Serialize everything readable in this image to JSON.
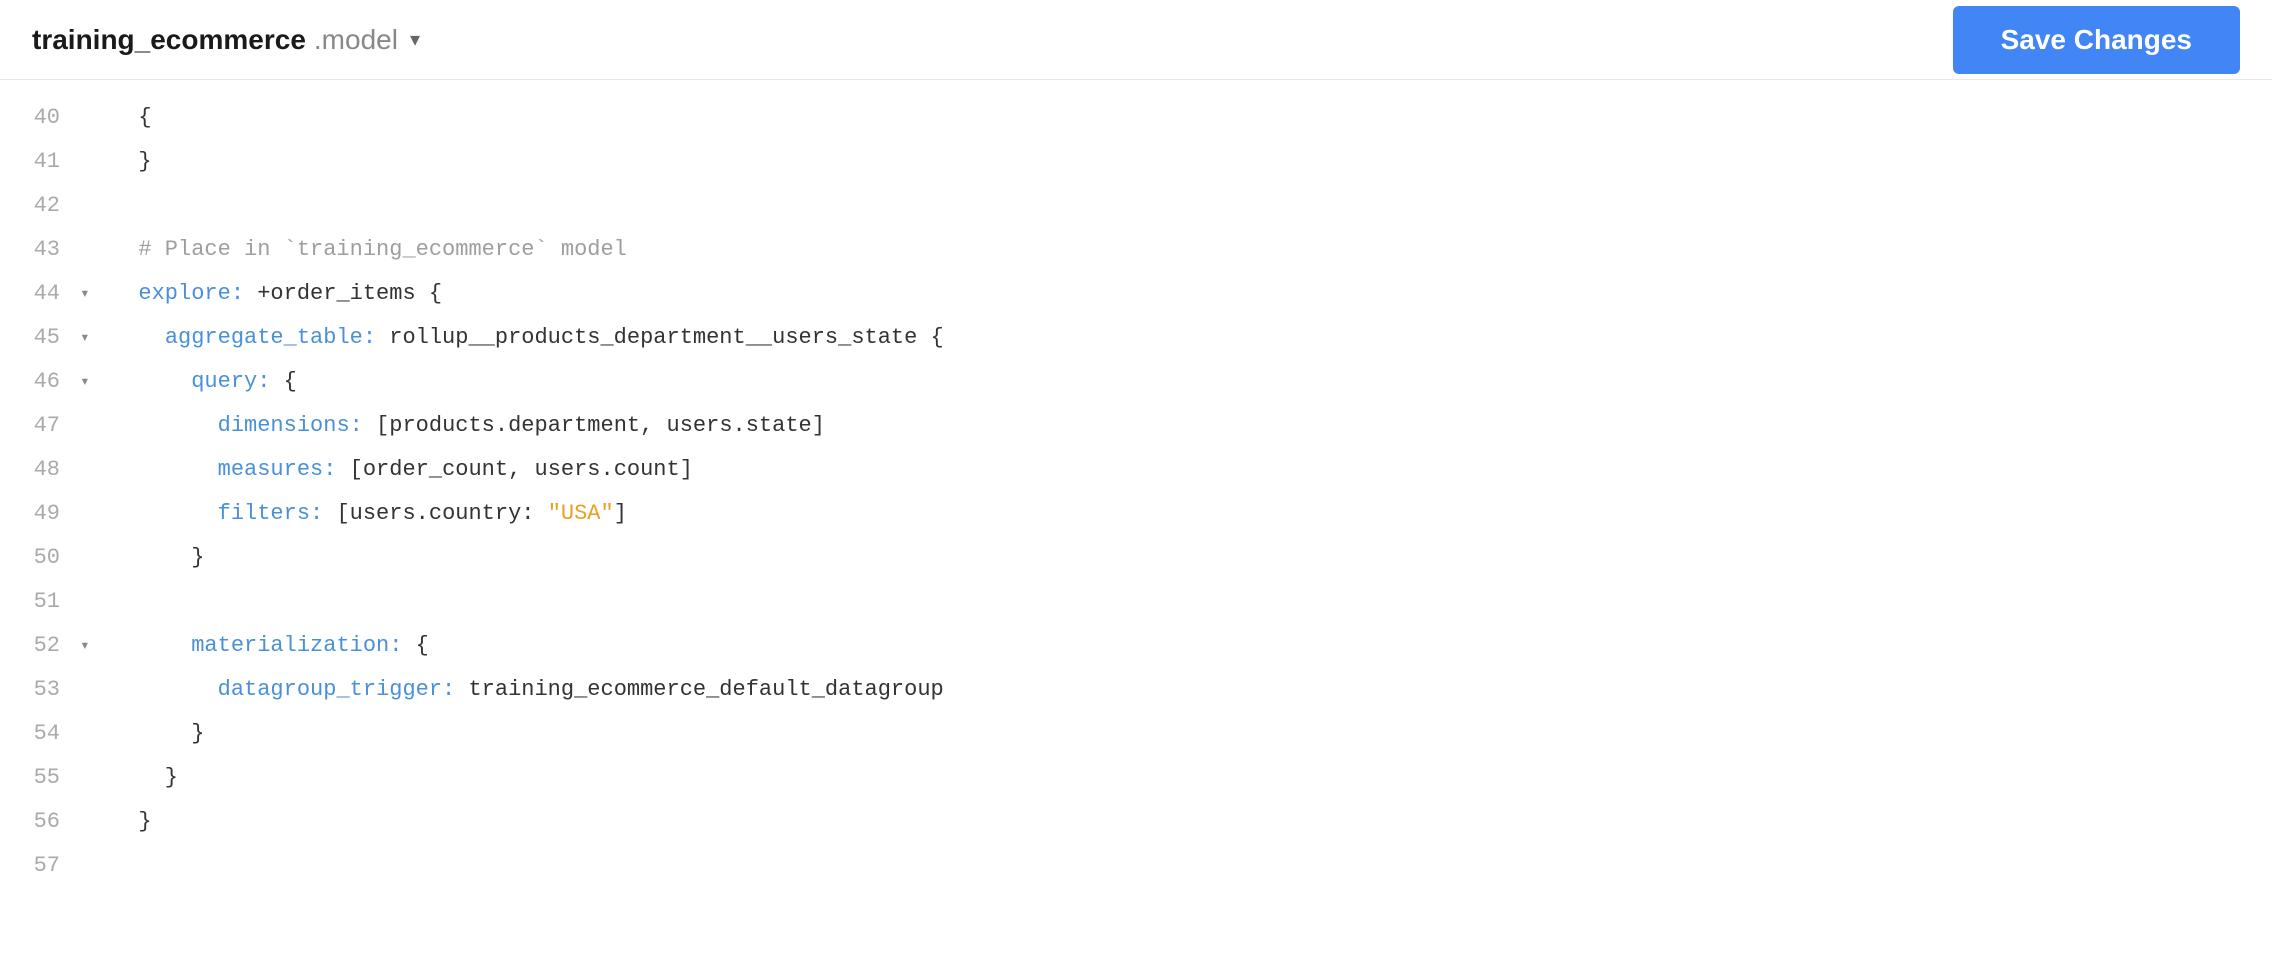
{
  "header": {
    "file_name": "training_ecommerce",
    "file_ext": ".model",
    "dropdown_icon": "▾",
    "save_button_label": "Save Changes"
  },
  "colors": {
    "save_btn_bg": "#4285f4",
    "keyword_blue": "#4a90d9",
    "string_orange": "#e8a020",
    "comment_gray": "#9e9e9e",
    "default_dark": "#444"
  },
  "lines": [
    {
      "num": "40",
      "fold": "",
      "tokens": [
        {
          "text": "  {",
          "class": "c-dark"
        }
      ]
    },
    {
      "num": "41",
      "fold": "",
      "tokens": [
        {
          "text": "  }",
          "class": "c-dark"
        }
      ]
    },
    {
      "num": "42",
      "fold": "",
      "tokens": []
    },
    {
      "num": "43",
      "fold": "",
      "tokens": [
        {
          "text": "  # Place in `training_ecommerce` model",
          "class": "c-comment"
        }
      ]
    },
    {
      "num": "44",
      "fold": "▾",
      "tokens": [
        {
          "text": "  ",
          "class": "c-default"
        },
        {
          "text": "explore:",
          "class": "c-blue"
        },
        {
          "text": " +order_items {",
          "class": "c-dark"
        }
      ]
    },
    {
      "num": "45",
      "fold": "▾",
      "tokens": [
        {
          "text": "    ",
          "class": "c-default"
        },
        {
          "text": "aggregate_table:",
          "class": "c-blue"
        },
        {
          "text": " rollup__products_department__users_state {",
          "class": "c-dark"
        }
      ]
    },
    {
      "num": "46",
      "fold": "▾",
      "tokens": [
        {
          "text": "      ",
          "class": "c-default"
        },
        {
          "text": "query:",
          "class": "c-blue"
        },
        {
          "text": " {",
          "class": "c-dark"
        }
      ]
    },
    {
      "num": "47",
      "fold": "",
      "tokens": [
        {
          "text": "        ",
          "class": "c-default"
        },
        {
          "text": "dimensions:",
          "class": "c-blue"
        },
        {
          "text": " [products.department, users.state]",
          "class": "c-dark"
        }
      ]
    },
    {
      "num": "48",
      "fold": "",
      "tokens": [
        {
          "text": "        ",
          "class": "c-default"
        },
        {
          "text": "measures:",
          "class": "c-blue"
        },
        {
          "text": " [order_count, users.count]",
          "class": "c-dark"
        }
      ]
    },
    {
      "num": "49",
      "fold": "",
      "tokens": [
        {
          "text": "        ",
          "class": "c-default"
        },
        {
          "text": "filters:",
          "class": "c-blue"
        },
        {
          "text": " [users.country: ",
          "class": "c-dark"
        },
        {
          "text": "\"USA\"",
          "class": "c-orange"
        },
        {
          "text": "]",
          "class": "c-dark"
        }
      ]
    },
    {
      "num": "50",
      "fold": "",
      "tokens": [
        {
          "text": "      }",
          "class": "c-dark"
        }
      ]
    },
    {
      "num": "51",
      "fold": "",
      "tokens": []
    },
    {
      "num": "52",
      "fold": "▾",
      "tokens": [
        {
          "text": "      ",
          "class": "c-default"
        },
        {
          "text": "materialization:",
          "class": "c-blue"
        },
        {
          "text": " {",
          "class": "c-dark"
        }
      ]
    },
    {
      "num": "53",
      "fold": "",
      "tokens": [
        {
          "text": "        ",
          "class": "c-default"
        },
        {
          "text": "datagroup_trigger:",
          "class": "c-blue"
        },
        {
          "text": " training_ecommerce_default_datagroup",
          "class": "c-dark"
        }
      ]
    },
    {
      "num": "54",
      "fold": "",
      "tokens": [
        {
          "text": "      }",
          "class": "c-dark"
        }
      ]
    },
    {
      "num": "55",
      "fold": "",
      "tokens": [
        {
          "text": "    }",
          "class": "c-dark"
        }
      ]
    },
    {
      "num": "56",
      "fold": "",
      "tokens": [
        {
          "text": "  }",
          "class": "c-dark"
        }
      ]
    },
    {
      "num": "57",
      "fold": "",
      "tokens": []
    }
  ]
}
